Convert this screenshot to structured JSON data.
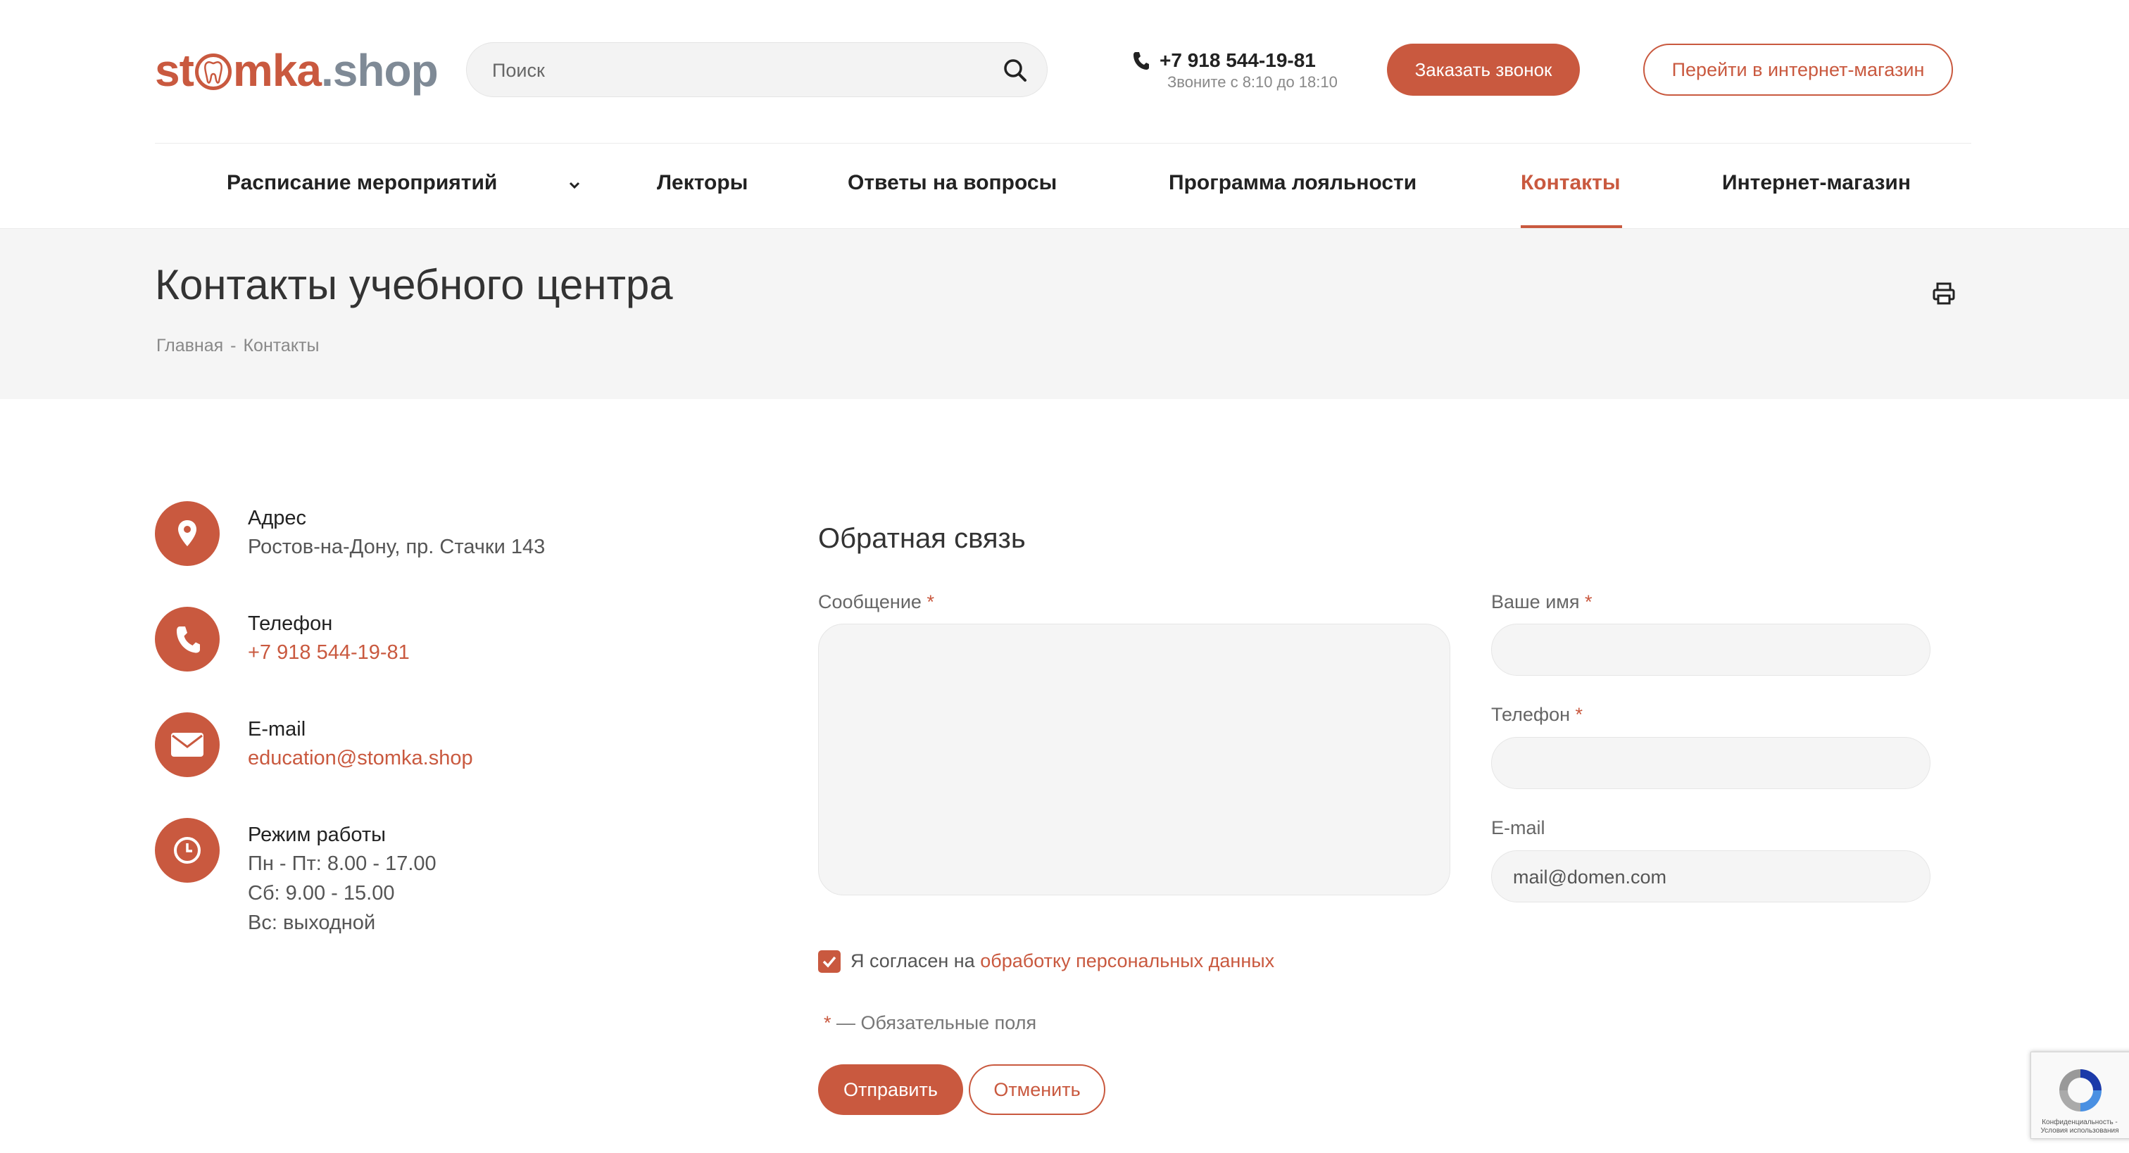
{
  "logo": {
    "part1": "st",
    "part2": "mka",
    "part3": ".shop"
  },
  "search": {
    "placeholder": "Поиск"
  },
  "header": {
    "phone": "+7 918 544-19-81",
    "phone_hours": "Звоните с 8:10 до 18:10",
    "call_button": "Заказать звонок",
    "shop_button": "Перейти в интернет-магазин"
  },
  "nav": {
    "items": [
      {
        "label": "Расписание мероприятий"
      },
      {
        "label": "Лекторы"
      },
      {
        "label": "Ответы на вопросы"
      },
      {
        "label": "Программа лояльности"
      },
      {
        "label": "Контакты"
      },
      {
        "label": "Интернет-магазин"
      }
    ],
    "active": "Контакты"
  },
  "page": {
    "title": "Контакты учебного центра",
    "breadcrumbs": [
      "Главная",
      "-",
      "Контакты"
    ]
  },
  "contacts": {
    "address": {
      "label": "Адрес",
      "value": "Ростов-на-Дону, пр. Стачки 143"
    },
    "phone": {
      "label": "Телефон",
      "value": "+7 918 544-19-81"
    },
    "email": {
      "label": "E-mail",
      "value": "education@stomka.shop"
    },
    "hours": {
      "label": "Режим работы",
      "lines": [
        "Пн - Пт: 8.00 - 17.00",
        "Сб: 9.00 - 15.00",
        "Вс: выходной"
      ]
    }
  },
  "form": {
    "title": "Обратная связь",
    "message_label": "Сообщение",
    "name_label": "Ваше имя",
    "phone_label": "Телефон",
    "email_label": "E-mail",
    "email_placeholder": "mail@domen.com",
    "required_mark": "*",
    "consent_prefix": "Я согласен на",
    "consent_link": "обработку персональных данных",
    "consent_checked": true,
    "required_note": "— Обязательные поля",
    "submit": "Отправить",
    "cancel": "Отменить"
  },
  "recaptcha": {
    "text": "Конфиденциальность - Условия использования"
  },
  "colors": {
    "accent": "#c9593f",
    "band": "#f5f5f5",
    "muted": "#7f8a96"
  }
}
